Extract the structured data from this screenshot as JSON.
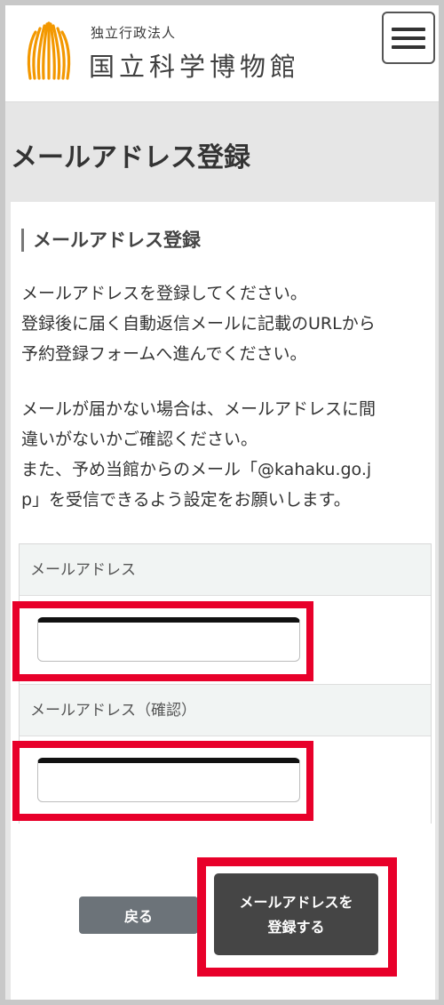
{
  "header": {
    "logo_sub": "独立行政法人",
    "logo_main": "国立科学博物館",
    "brand_color": "#f39800"
  },
  "page": {
    "title": "メールアドレス登録"
  },
  "section": {
    "heading": "メールアドレス登録",
    "para1": [
      "メールアドレスを登録してください。",
      "登録後に届く自動返信メールに記載のURLから",
      "予約登録フォームへ進んでください。"
    ],
    "para2": [
      "メールが届かない場合は、メールアドレスに間",
      "違いがないかご確認ください。",
      "また、予め当館からのメール「@kahaku.go.j",
      "p」を受信できるよう設定をお願いします。"
    ]
  },
  "form": {
    "email_label": "メールアドレス",
    "email_value": "",
    "email_confirm_label": "メールアドレス（確認）",
    "email_confirm_value": ""
  },
  "buttons": {
    "back_label": "戻る",
    "submit_label_line1": "メールアドレスを",
    "submit_label_line2": "登録する"
  },
  "colors": {
    "highlight": "#e8002a",
    "submit_bg": "#454545",
    "back_bg": "#6c7379"
  }
}
